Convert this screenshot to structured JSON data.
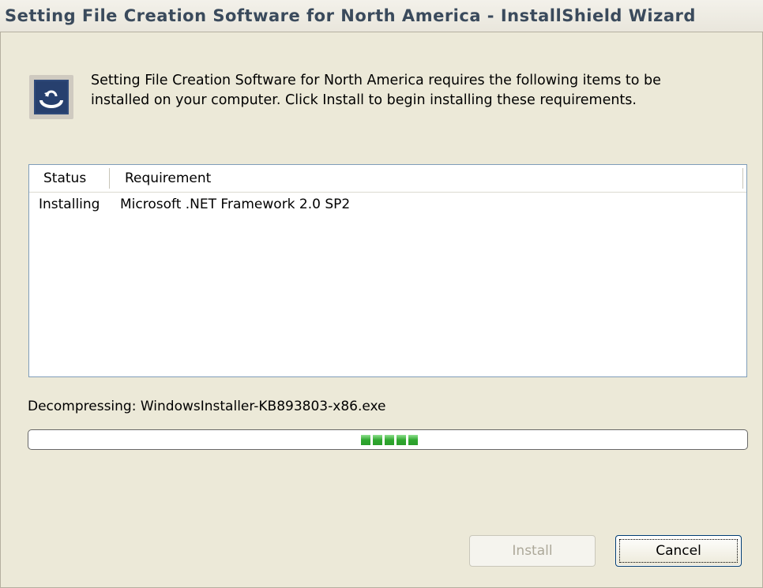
{
  "window": {
    "title": "Setting File Creation Software for North America - InstallShield Wizard"
  },
  "intro": {
    "icon": "installshield-icon",
    "text": "Setting File Creation Software for North America requires the following items to be installed on your computer. Click Install to begin installing these requirements."
  },
  "requirements": {
    "columns": [
      "Status",
      "Requirement"
    ],
    "rows": [
      {
        "status": "Installing",
        "requirement": "Microsoft .NET Framework 2.0 SP2"
      }
    ]
  },
  "progress": {
    "label": "Decompressing: WindowsInstaller-KB893803-x86.exe",
    "style": "marquee",
    "color": "#2fa82f"
  },
  "buttons": {
    "install": "Install",
    "cancel": "Cancel"
  }
}
